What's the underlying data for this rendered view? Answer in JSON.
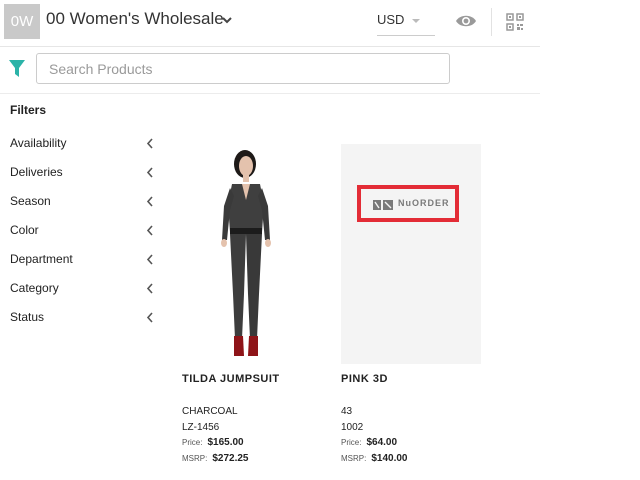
{
  "header": {
    "avatar_initials": "0W",
    "store_title": "00 Women's Wholesale",
    "currency": "USD"
  },
  "search": {
    "placeholder": "Search Products"
  },
  "filters": {
    "heading": "Filters",
    "items": [
      "Availability",
      "Deliveries",
      "Season",
      "Color",
      "Department",
      "Category",
      "Status"
    ]
  },
  "products": [
    {
      "name": "TILDA JUMPSUIT",
      "color": "CHARCOAL",
      "sku": "LZ-1456",
      "price_label": "Price:",
      "price": "$165.00",
      "msrp_label": "MSRP:",
      "msrp": "$272.25"
    },
    {
      "name": "PINK 3D",
      "color": "43",
      "sku": "1002",
      "price_label": "Price:",
      "price": "$64.00",
      "msrp_label": "MSRP:",
      "msrp": "$140.00",
      "placeholder_logo_text": "NuORDER"
    }
  ],
  "colors": {
    "accent_teal": "#2bb3a8",
    "highlight_red": "#e32c36"
  }
}
